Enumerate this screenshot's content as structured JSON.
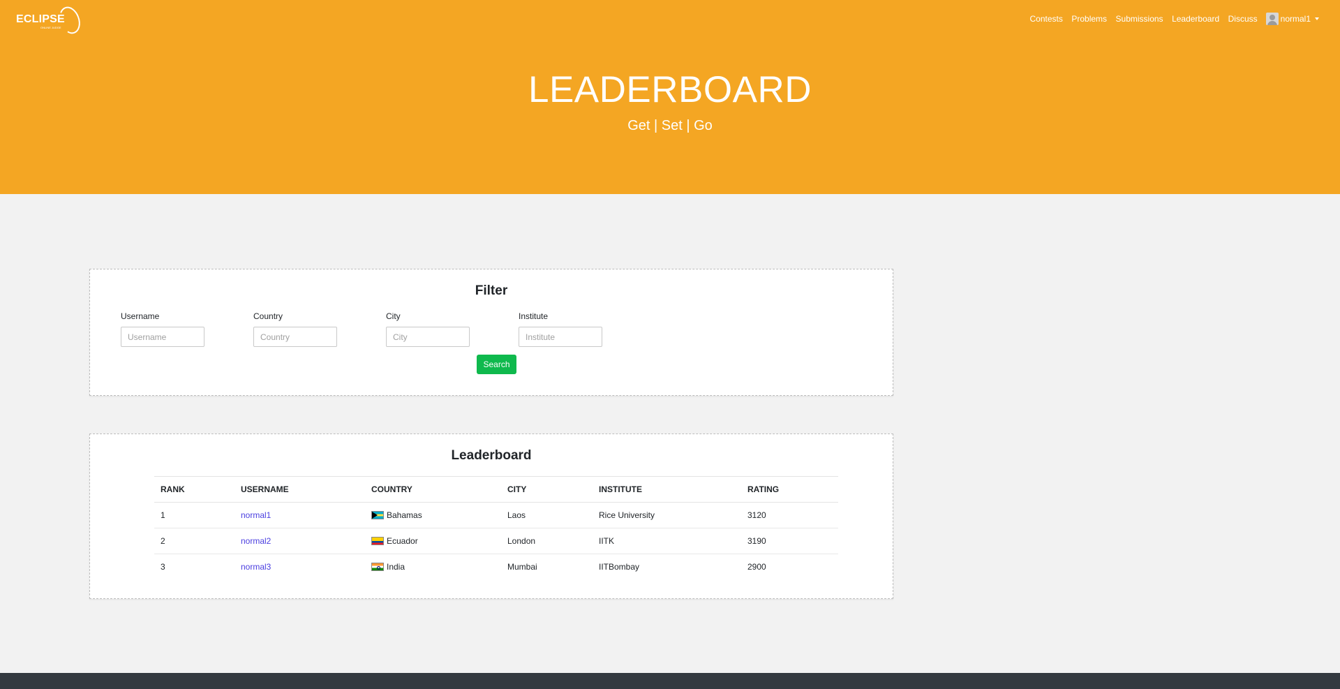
{
  "brand": {
    "logo_text": "ECLIPSE",
    "logo_sub": "ONLINE JUDGE"
  },
  "nav": {
    "items": [
      "Contests",
      "Problems",
      "Submissions",
      "Leaderboard",
      "Discuss"
    ],
    "user": "normal1"
  },
  "hero": {
    "title": "LEADERBOARD",
    "subtitle": "Get | Set | Go"
  },
  "filter": {
    "title": "Filter",
    "fields": [
      {
        "label": "Username",
        "placeholder": "Username",
        "value": ""
      },
      {
        "label": "Country",
        "placeholder": "Country",
        "value": ""
      },
      {
        "label": "City",
        "placeholder": "City",
        "value": ""
      },
      {
        "label": "Institute",
        "placeholder": "Institute",
        "value": ""
      }
    ],
    "search_label": "Search"
  },
  "leaderboard": {
    "title": "Leaderboard",
    "columns": [
      "RANK",
      "USERNAME",
      "COUNTRY",
      "CITY",
      "INSTITUTE",
      "RATING"
    ],
    "rows": [
      {
        "rank": "1",
        "username": "normal1",
        "flag": "flag-bahamas",
        "country": "Bahamas",
        "city": "Laos",
        "institute": "Rice University",
        "rating": "3120"
      },
      {
        "rank": "2",
        "username": "normal2",
        "flag": "flag-ecuador",
        "country": "Ecuador",
        "city": "London",
        "institute": "IITK",
        "rating": "3190"
      },
      {
        "rank": "3",
        "username": "normal3",
        "flag": "flag-india",
        "country": "India",
        "city": "Mumbai",
        "institute": "IITBombay",
        "rating": "2900"
      }
    ]
  },
  "colors": {
    "hero": "#f4a623",
    "search_button": "#0fb94d",
    "link": "#4a3ee0",
    "footer": "#343a40"
  }
}
